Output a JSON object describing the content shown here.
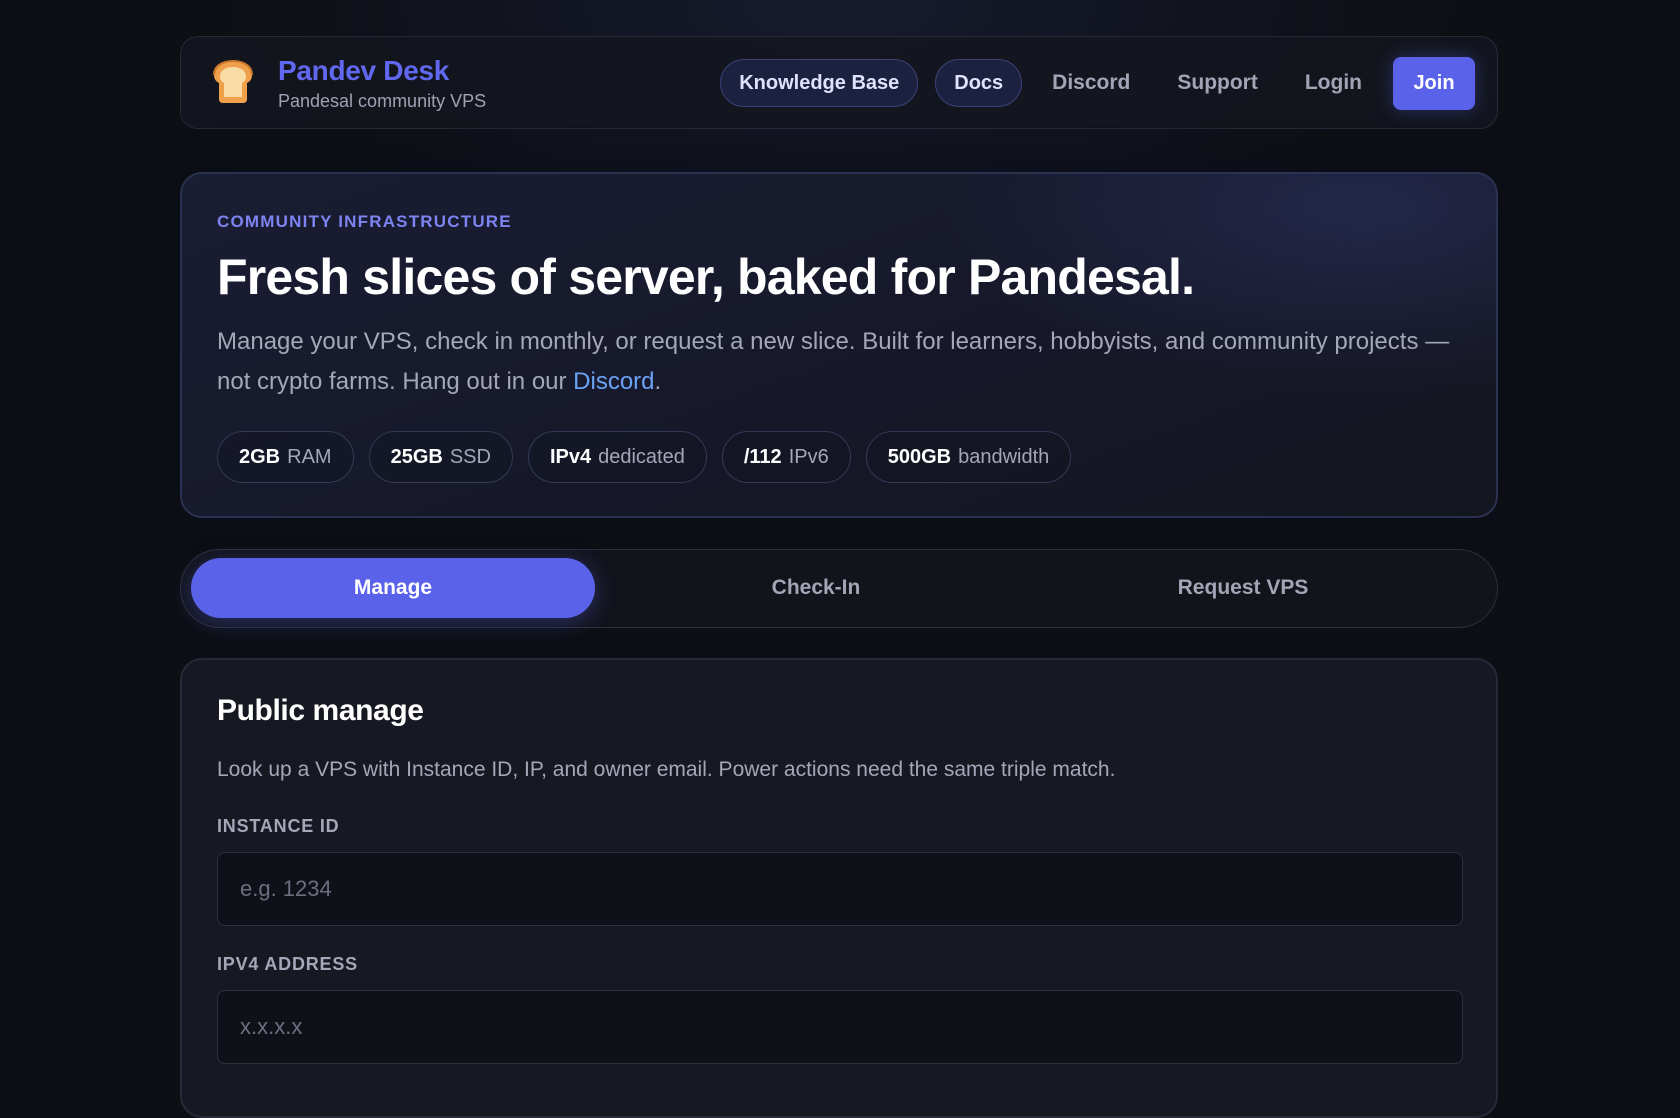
{
  "brand": {
    "title": "Pandev Desk",
    "subtitle": "Pandesal community VPS",
    "logo_icon": "bread-icon"
  },
  "nav": {
    "knowledge_base": "Knowledge Base",
    "docs": "Docs",
    "discord": "Discord",
    "support": "Support",
    "login": "Login",
    "join": "Join"
  },
  "hero": {
    "eyebrow": "COMMUNITY INFRASTRUCTURE",
    "title": "Fresh slices of server, baked for Pandesal.",
    "desc_before": "Manage your VPS, check in monthly, or request a new slice. Built for learners, hobbyists, and community projects — not crypto farms. Hang out in our ",
    "desc_link": "Discord",
    "desc_after": ".",
    "chips": [
      {
        "value": "2GB",
        "label": "RAM"
      },
      {
        "value": "25GB",
        "label": "SSD"
      },
      {
        "value": "IPv4",
        "label": "dedicated"
      },
      {
        "value": "/112",
        "label": "IPv6"
      },
      {
        "value": "500GB",
        "label": "bandwidth"
      }
    ]
  },
  "tabs": [
    {
      "label": "Manage",
      "active": true
    },
    {
      "label": "Check-In",
      "active": false
    },
    {
      "label": "Request VPS",
      "active": false
    }
  ],
  "manage": {
    "title": "Public manage",
    "description": "Look up a VPS with Instance ID, IP, and owner email. Power actions need the same triple match.",
    "instance_id": {
      "label": "INSTANCE ID",
      "value": "",
      "placeholder": "e.g. 1234"
    },
    "ipv4": {
      "label": "IPV4 ADDRESS",
      "value": "",
      "placeholder": "x.x.x.x"
    }
  },
  "colors": {
    "accent": "#5a62ea",
    "brand": "#6168f0",
    "link": "#6aa2f4",
    "background": "#0d0f14"
  }
}
